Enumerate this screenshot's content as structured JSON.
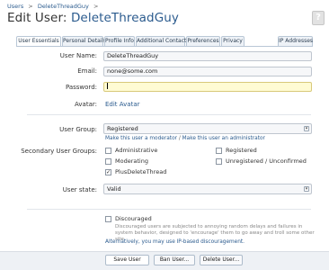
{
  "breadcrumb": {
    "items": [
      "Users",
      "DeleteThreadGuy"
    ],
    "separator": ">"
  },
  "page": {
    "title_prefix": "Edit User:",
    "title_name": "DeleteThreadGuy",
    "help_label": "?"
  },
  "tabs": [
    {
      "label": "User Essentials",
      "active": true
    },
    {
      "label": "Personal Details",
      "active": false
    },
    {
      "label": "Profile Info",
      "active": false
    },
    {
      "label": "Additional Contact",
      "active": false
    },
    {
      "label": "Preferences",
      "active": false
    },
    {
      "label": "Privacy",
      "active": false
    },
    {
      "label": "IP Addresses",
      "active": false
    }
  ],
  "form": {
    "username": {
      "label": "User Name:",
      "value": "DeleteThreadGuy"
    },
    "email": {
      "label": "Email:",
      "value": "none@some.com"
    },
    "password": {
      "label": "Password:",
      "value": ""
    },
    "avatar": {
      "label": "Avatar:",
      "link": "Edit Avatar"
    },
    "user_group": {
      "label": "User Group:",
      "selected": "Registered",
      "links": [
        "Make this user a moderator",
        "Make this user an administrator"
      ],
      "link_separator": "/"
    },
    "secondary_groups": {
      "label": "Secondary User Groups:",
      "options": [
        {
          "label": "Administrative",
          "checked": false
        },
        {
          "label": "Registered",
          "checked": false
        },
        {
          "label": "Moderating",
          "checked": false
        },
        {
          "label": "Unregistered / Unconfirmed",
          "checked": false
        },
        {
          "label": "PlusDeleteThread",
          "checked": true
        }
      ]
    },
    "user_state": {
      "label": "User state:",
      "selected": "Valid"
    },
    "discouraged": {
      "label": "Discouraged",
      "checked": false,
      "explain": "Discouraged users are subjected to annoying random delays and failures in system behavior, designed to 'encourage' them to go away and troll some other site.",
      "ip_note": "Alternatively, you may use IP-based discouragement."
    }
  },
  "buttons": {
    "save": "Save User",
    "ban": "Ban User...",
    "delete": "Delete User..."
  },
  "colors": {
    "link": "#2b5b8e",
    "focus_field": "#fffbd3",
    "tab_border": "#b9c7d6"
  }
}
